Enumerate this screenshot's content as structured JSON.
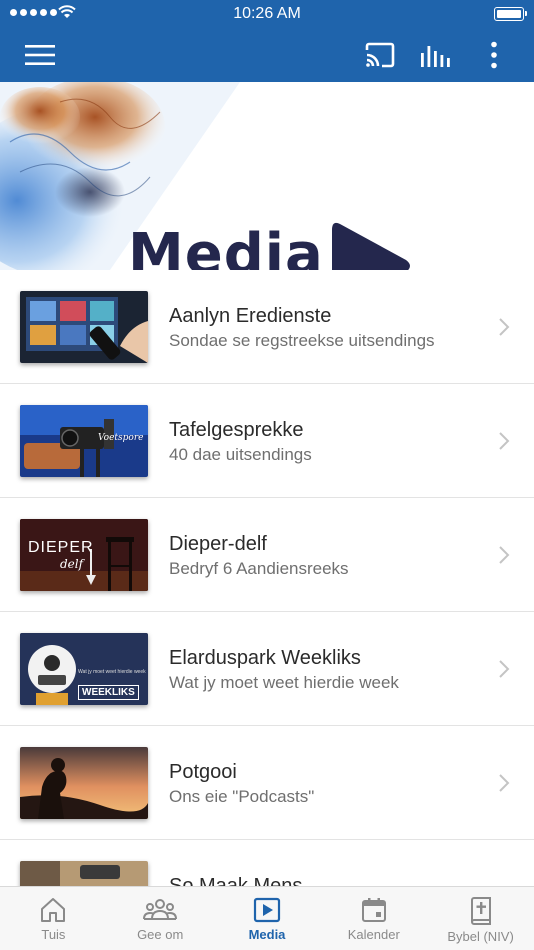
{
  "status_bar": {
    "time": "10:26 AM"
  },
  "app_bar": {
    "menu_icon": "hamburger-menu-icon",
    "cast_icon": "cast-icon",
    "equalizer_icon": "equalizer-icon",
    "more_icon": "more-vertical-icon"
  },
  "hero": {
    "title": "Media"
  },
  "items": [
    {
      "title": "Aanlyn Eredienste",
      "subtitle": "Sondae se regstreekse uitsendings"
    },
    {
      "title": "Tafelgesprekke",
      "subtitle": "40 dae uitsendings",
      "thumb_text": "Voetspore"
    },
    {
      "title": "Dieper-delf",
      "subtitle": "Bedryf 6 Aandiensreeks",
      "thumb_text": "DIEPER",
      "thumb_text2": "delf"
    },
    {
      "title": "Elarduspark Weekliks",
      "subtitle": "Wat jy moet weet hierdie week",
      "thumb_text": "WEEKLIKS",
      "thumb_text2": "Wat jy moet weet hierdie week"
    },
    {
      "title": "Potgooi",
      "subtitle": "Ons eie \"Podcasts\""
    },
    {
      "title": "So Maak Mens",
      "subtitle": ""
    }
  ],
  "tabs": [
    {
      "label": "Tuis",
      "icon": "home-icon"
    },
    {
      "label": "Gee om",
      "icon": "people-icon"
    },
    {
      "label": "Media",
      "icon": "play-square-icon",
      "active": true
    },
    {
      "label": "Kalender",
      "icon": "calendar-icon"
    },
    {
      "label": "Bybel (NIV)",
      "icon": "bible-icon"
    }
  ],
  "colors": {
    "brand": "#1f64ac",
    "hero_text": "#24274d",
    "tab_inactive": "#8a8a8a"
  }
}
